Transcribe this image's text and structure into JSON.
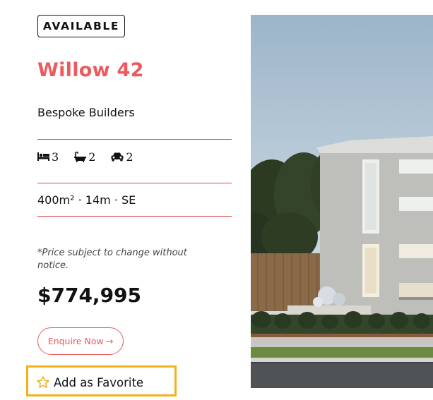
{
  "listing": {
    "status_badge": "AVAILABLE",
    "title": "Willow 42",
    "builder": "Bespoke Builders",
    "features": {
      "beds": "3",
      "baths": "2",
      "cars": "2"
    },
    "specs": "400m² · 14m · SE",
    "price_note": "*Price subject to change without notice.",
    "price": "$774,995",
    "enquire_label": "Enquire Now",
    "enquire_arrow": "→",
    "favorite_label": "Add as Favorite"
  },
  "colors": {
    "accent": "#ec5a5f",
    "divider": "#d9444a",
    "highlight": "#f2b21b",
    "text": "#111111"
  },
  "icons": {
    "bed": "bed-icon",
    "bath": "bath-icon",
    "car": "car-icon",
    "arrow": "arrow-right-icon",
    "favorite": "star-outline-icon"
  }
}
